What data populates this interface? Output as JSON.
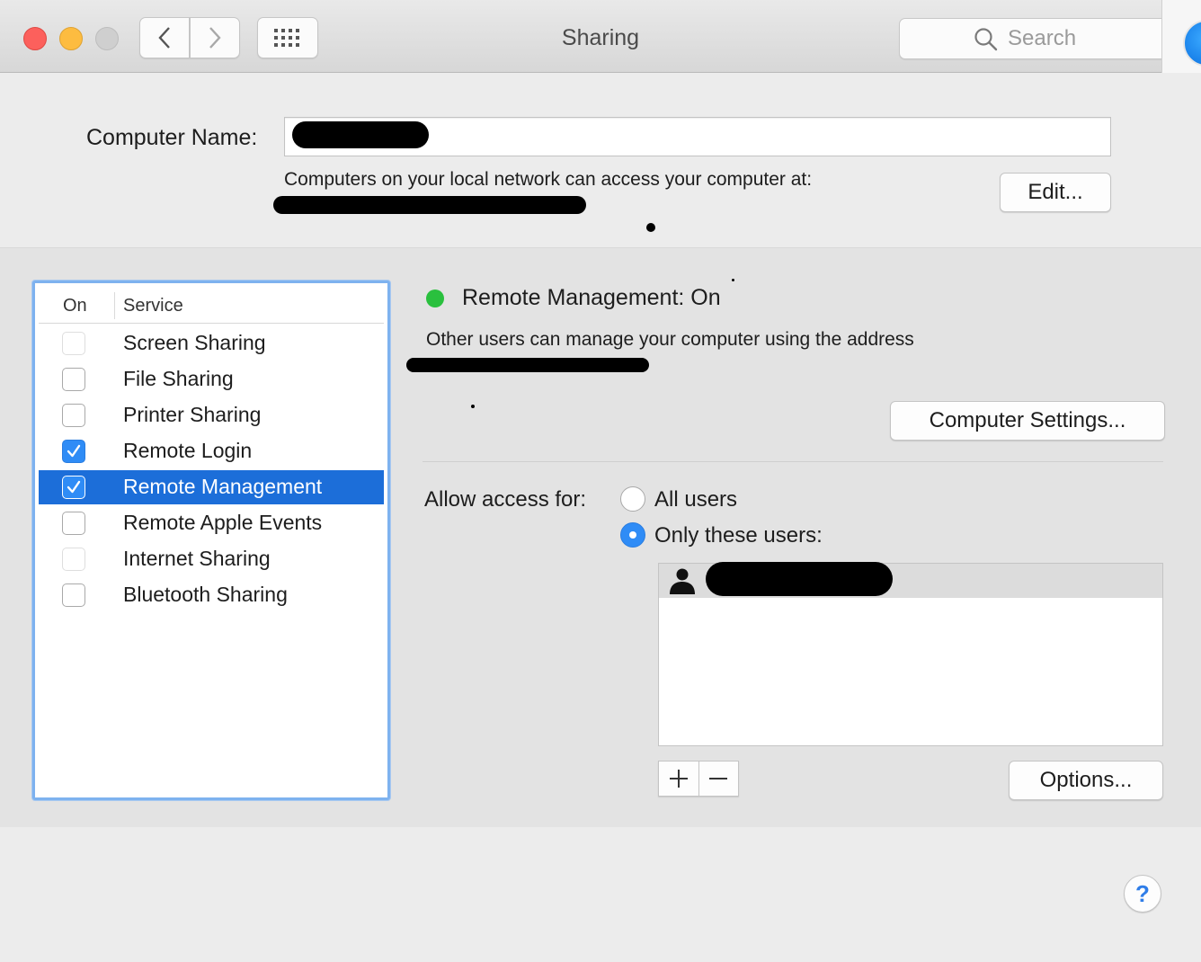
{
  "window": {
    "title": "Sharing",
    "search_placeholder": "Search"
  },
  "computer_name": {
    "label": "Computer Name:",
    "value": "",
    "access_text": "Computers on your local network can access your computer at:",
    "edit_button": "Edit..."
  },
  "services": {
    "header_on": "On",
    "header_service": "Service",
    "items": [
      {
        "label": "Screen Sharing",
        "checked": false
      },
      {
        "label": "File Sharing",
        "checked": false
      },
      {
        "label": "Printer Sharing",
        "checked": false
      },
      {
        "label": "Remote Login",
        "checked": true
      },
      {
        "label": "Remote Management",
        "checked": true,
        "selected": true
      },
      {
        "label": "Remote Apple Events",
        "checked": false
      },
      {
        "label": "Internet Sharing",
        "checked": false
      },
      {
        "label": "Bluetooth Sharing",
        "checked": false
      }
    ]
  },
  "detail": {
    "status_text": "Remote Management: On",
    "status_color": "#2ac03e",
    "manage_text": "Other users can manage your computer using the address",
    "computer_settings_button": "Computer Settings...",
    "allow_access_label": "Allow access for:",
    "all_users_label": "All users",
    "only_these_users_label": "Only these users:",
    "selected_option": "only_these_users",
    "add_symbol": "+",
    "remove_symbol": "−",
    "options_button": "Options..."
  },
  "help": {
    "symbol": "?"
  },
  "colors": {
    "accent": "#1c6ed9",
    "checkbox": "#2f8cf6",
    "close": "#fc605c",
    "minimize": "#fdbc40"
  }
}
